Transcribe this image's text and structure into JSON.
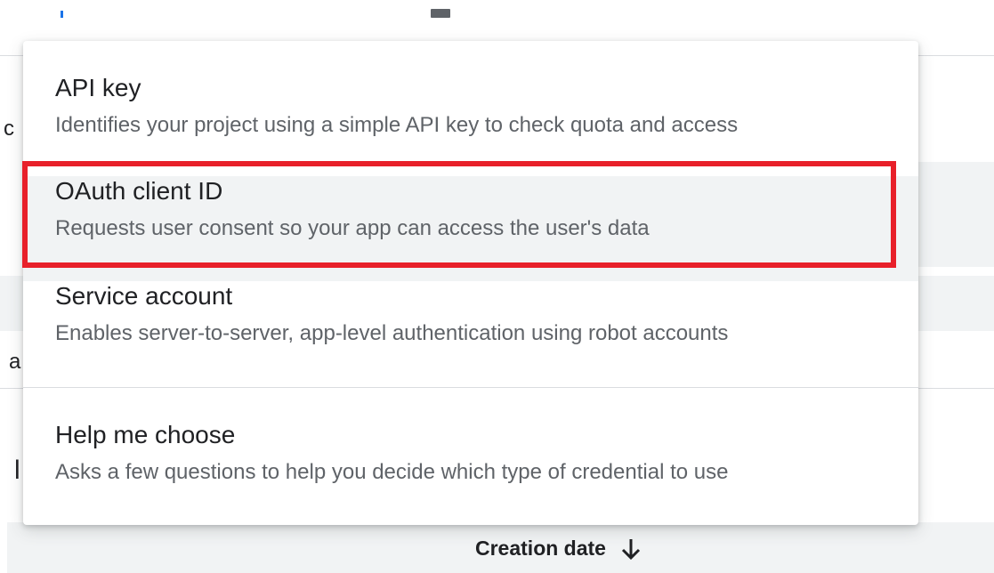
{
  "background": {
    "fragment_left_1": "c",
    "fragment_left_2": "a",
    "fragment_left_3": "l",
    "sort_header": {
      "label": "Creation date",
      "icon": "arrow-down-icon"
    }
  },
  "credential_menu": {
    "items": [
      {
        "title": "API key",
        "description": "Identifies your project using a simple API key to check quota and access"
      },
      {
        "title": "OAuth client ID",
        "description": "Requests user consent so your app can access the user's data",
        "highlighted": true
      },
      {
        "title": "Service account",
        "description": "Enables server-to-server, app-level authentication using robot accounts"
      },
      {
        "title": "Help me choose",
        "description": "Asks a few questions to help you decide which type of credential to use"
      }
    ]
  },
  "colors": {
    "highlight_border": "#e8202a",
    "hover_background": "#f1f3f4",
    "title_text": "#202124",
    "description_text": "#5f6368"
  }
}
